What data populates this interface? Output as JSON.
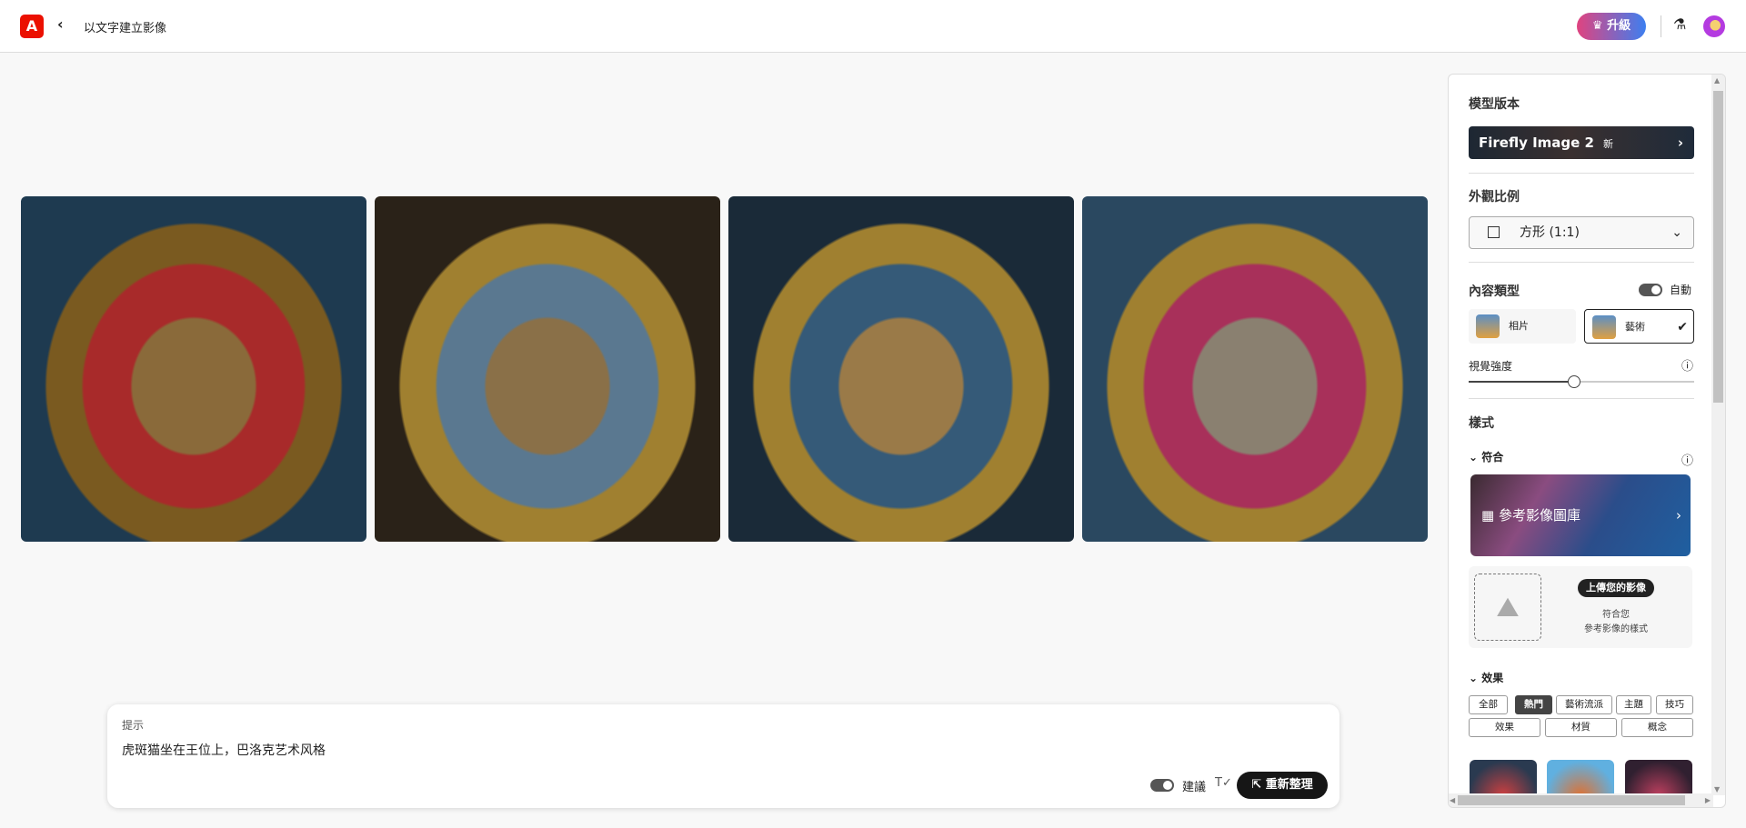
{
  "header": {
    "logo": "A",
    "back_icon": "chevron-left-icon",
    "title": "以文字建立影像",
    "upgrade_label": "升級",
    "upgrade_gradient": [
      "#e0437f",
      "#3d7ff0"
    ]
  },
  "images": [
    {
      "label": "cat-on-red-throne"
    },
    {
      "label": "cat-on-blue-throne"
    },
    {
      "label": "cat-on-blue-gold-throne"
    },
    {
      "label": "cat-on-pink-throne"
    }
  ],
  "prompt": {
    "label": "提示",
    "value": "虎斑猫坐在王位上，巴洛克艺术风格",
    "suggest_label": "建議",
    "suggest_on": true,
    "regenerate_label": "重新整理"
  },
  "panel": {
    "model": {
      "heading": "模型版本",
      "name": "Firefly Image 2",
      "badge": "新"
    },
    "aspect": {
      "heading": "外觀比例",
      "value": "方形 (1:1)"
    },
    "content_type": {
      "heading": "內容類型",
      "auto_label": "自動",
      "auto_on": true,
      "options": [
        {
          "label": "相片",
          "selected": false
        },
        {
          "label": "藝術",
          "selected": true
        }
      ]
    },
    "visual_intensity": {
      "label": "視覺強度",
      "value_fraction": 0.5
    },
    "style": {
      "heading": "樣式",
      "match_label": "符合",
      "gallery_label": "參考影像圖庫",
      "upload_button": "上傳您的影像",
      "upload_line1": "符合您",
      "upload_line2": "參考影像的樣式"
    },
    "effects": {
      "heading": "效果",
      "chips_row1": [
        "全部",
        "熱門",
        "藝術流派",
        "主題",
        "技巧"
      ],
      "chips_row2": [
        "效果",
        "材質",
        "概念"
      ],
      "active": "熱門"
    }
  }
}
